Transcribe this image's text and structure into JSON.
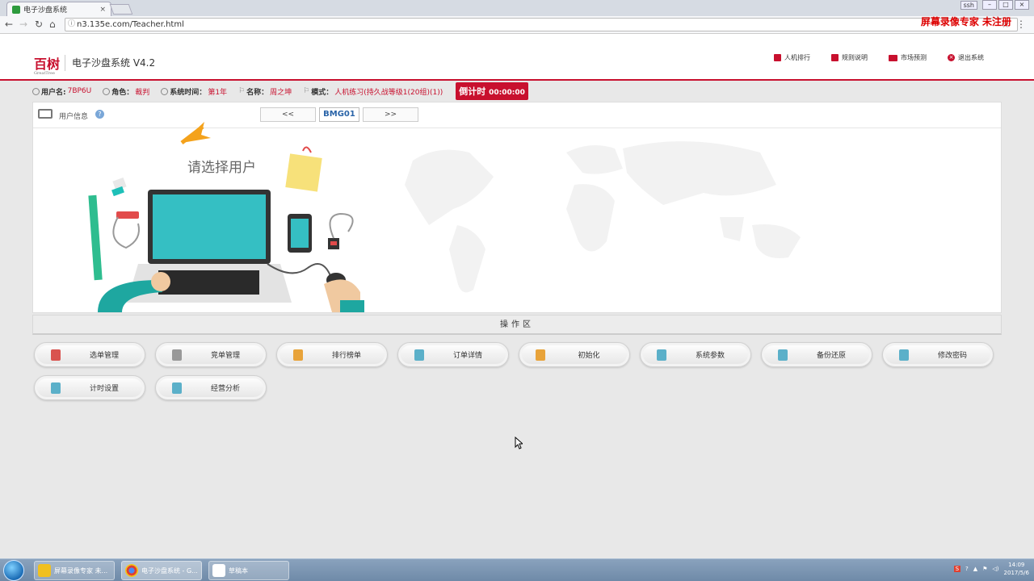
{
  "browser": {
    "tab_title": "电子沙盘系统",
    "tab_close": "×",
    "url": "n3.135e.com/Teacher.html",
    "user_badge": "ssh",
    "watermark": "屏幕录像专家  未注册"
  },
  "header": {
    "logo_text": "百树",
    "logo_sub": "GreatTree",
    "app_title": "电子沙盘系统 V4.2",
    "nav": [
      {
        "label": "人机排行",
        "icon": "ranking-icon"
      },
      {
        "label": "规则说明",
        "icon": "rules-icon"
      },
      {
        "label": "市场预测",
        "icon": "mail-icon"
      },
      {
        "label": "退出系统",
        "icon": "exit-icon"
      }
    ]
  },
  "infobar": {
    "username_label": "用户名:",
    "username_value": "7BP6U",
    "role_label": "角色：",
    "role_value": "裁判",
    "time_label": "系统时间：",
    "time_value": "第1年",
    "name_label": "名称：",
    "name_value": "周之坤",
    "mode_label": "模式：",
    "mode_value": "人机练习(持久战等级1(20组)(1))",
    "countdown_label": "倒计时",
    "countdown_value": "00:00:00"
  },
  "panel": {
    "title": "用户信息",
    "help": "?",
    "prev": "<<",
    "current": "BMG01",
    "next": ">>",
    "prompt": "请选择用户"
  },
  "ops": {
    "title": "操作区",
    "buttons": [
      {
        "label": "选单管理",
        "icon": "select-order-icon",
        "color": "#d9534f"
      },
      {
        "label": "竞单管理",
        "icon": "bid-icon",
        "color": "#999999"
      },
      {
        "label": "排行榜单",
        "icon": "ranking-list-icon",
        "color": "#e8a33a"
      },
      {
        "label": "订单详情",
        "icon": "order-detail-icon",
        "color": "#5bb0c9"
      },
      {
        "label": "初始化",
        "icon": "home-icon",
        "color": "#e8a33a"
      },
      {
        "label": "系统参数",
        "icon": "system-params-icon",
        "color": "#5bb0c9"
      },
      {
        "label": "备份还原",
        "icon": "backup-icon",
        "color": "#5bb0c9"
      },
      {
        "label": "修改密码",
        "icon": "password-icon",
        "color": "#5bb0c9"
      },
      {
        "label": "计时设置",
        "icon": "timer-settings-icon",
        "color": "#5bb0c9"
      },
      {
        "label": "经营分析",
        "icon": "analysis-icon",
        "color": "#5bb0c9"
      }
    ]
  },
  "taskbar": {
    "tasks": [
      {
        "label": "屏幕录像专家 未...",
        "color": "#f0c020"
      },
      {
        "label": "电子沙盘系统 - G...",
        "color": "#e04030"
      },
      {
        "label": "草稿本",
        "color": "#ffffff"
      }
    ],
    "time": "14:09",
    "date": "2017/5/6"
  }
}
